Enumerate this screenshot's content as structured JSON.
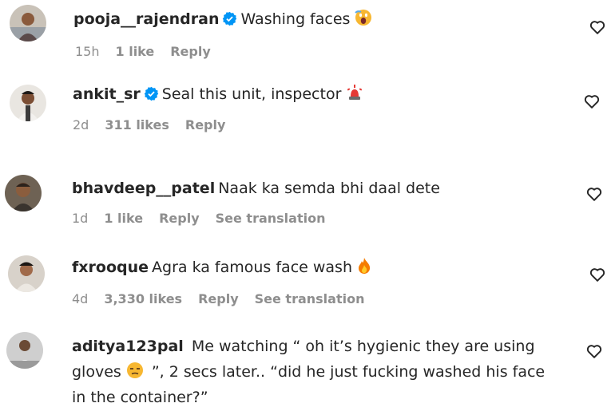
{
  "comments": [
    {
      "username": "pooja__rajendran",
      "verified": true,
      "text": "Washing faces",
      "emoji_icon": "face-screaming-icon",
      "time": "15h",
      "likes": "1 like",
      "reply": "Reply",
      "translation": ""
    },
    {
      "username": "ankit_sr",
      "verified": true,
      "text": "Seal this unit, inspector",
      "emoji_icon": "police-siren-icon",
      "time": "2d",
      "likes": "311 likes",
      "reply": "Reply",
      "translation": ""
    },
    {
      "username": "bhavdeep__patel",
      "verified": false,
      "text": "Naak ka semda bhi daal dete",
      "time": "1d",
      "likes": "1 like",
      "reply": "Reply",
      "translation": "See translation"
    },
    {
      "username": "fxrooque",
      "verified": false,
      "text": "Agra ka famous face wash",
      "emoji_icon": "fire-icon",
      "time": "4d",
      "likes": "3,330 likes",
      "reply": "Reply",
      "translation": "See translation"
    },
    {
      "username": "aditya123pal",
      "verified": false,
      "text_part1": "Me watching “ oh it’s hygienic they are using gloves",
      "emoji_icon": "unamused-face-icon",
      "text_part2": "”, 2 secs later.. “did he just fucking washed his face in the container?”"
    }
  ],
  "colors": {
    "text": "#262626",
    "muted": "#8e8e8e",
    "verified": "#0095f6"
  }
}
